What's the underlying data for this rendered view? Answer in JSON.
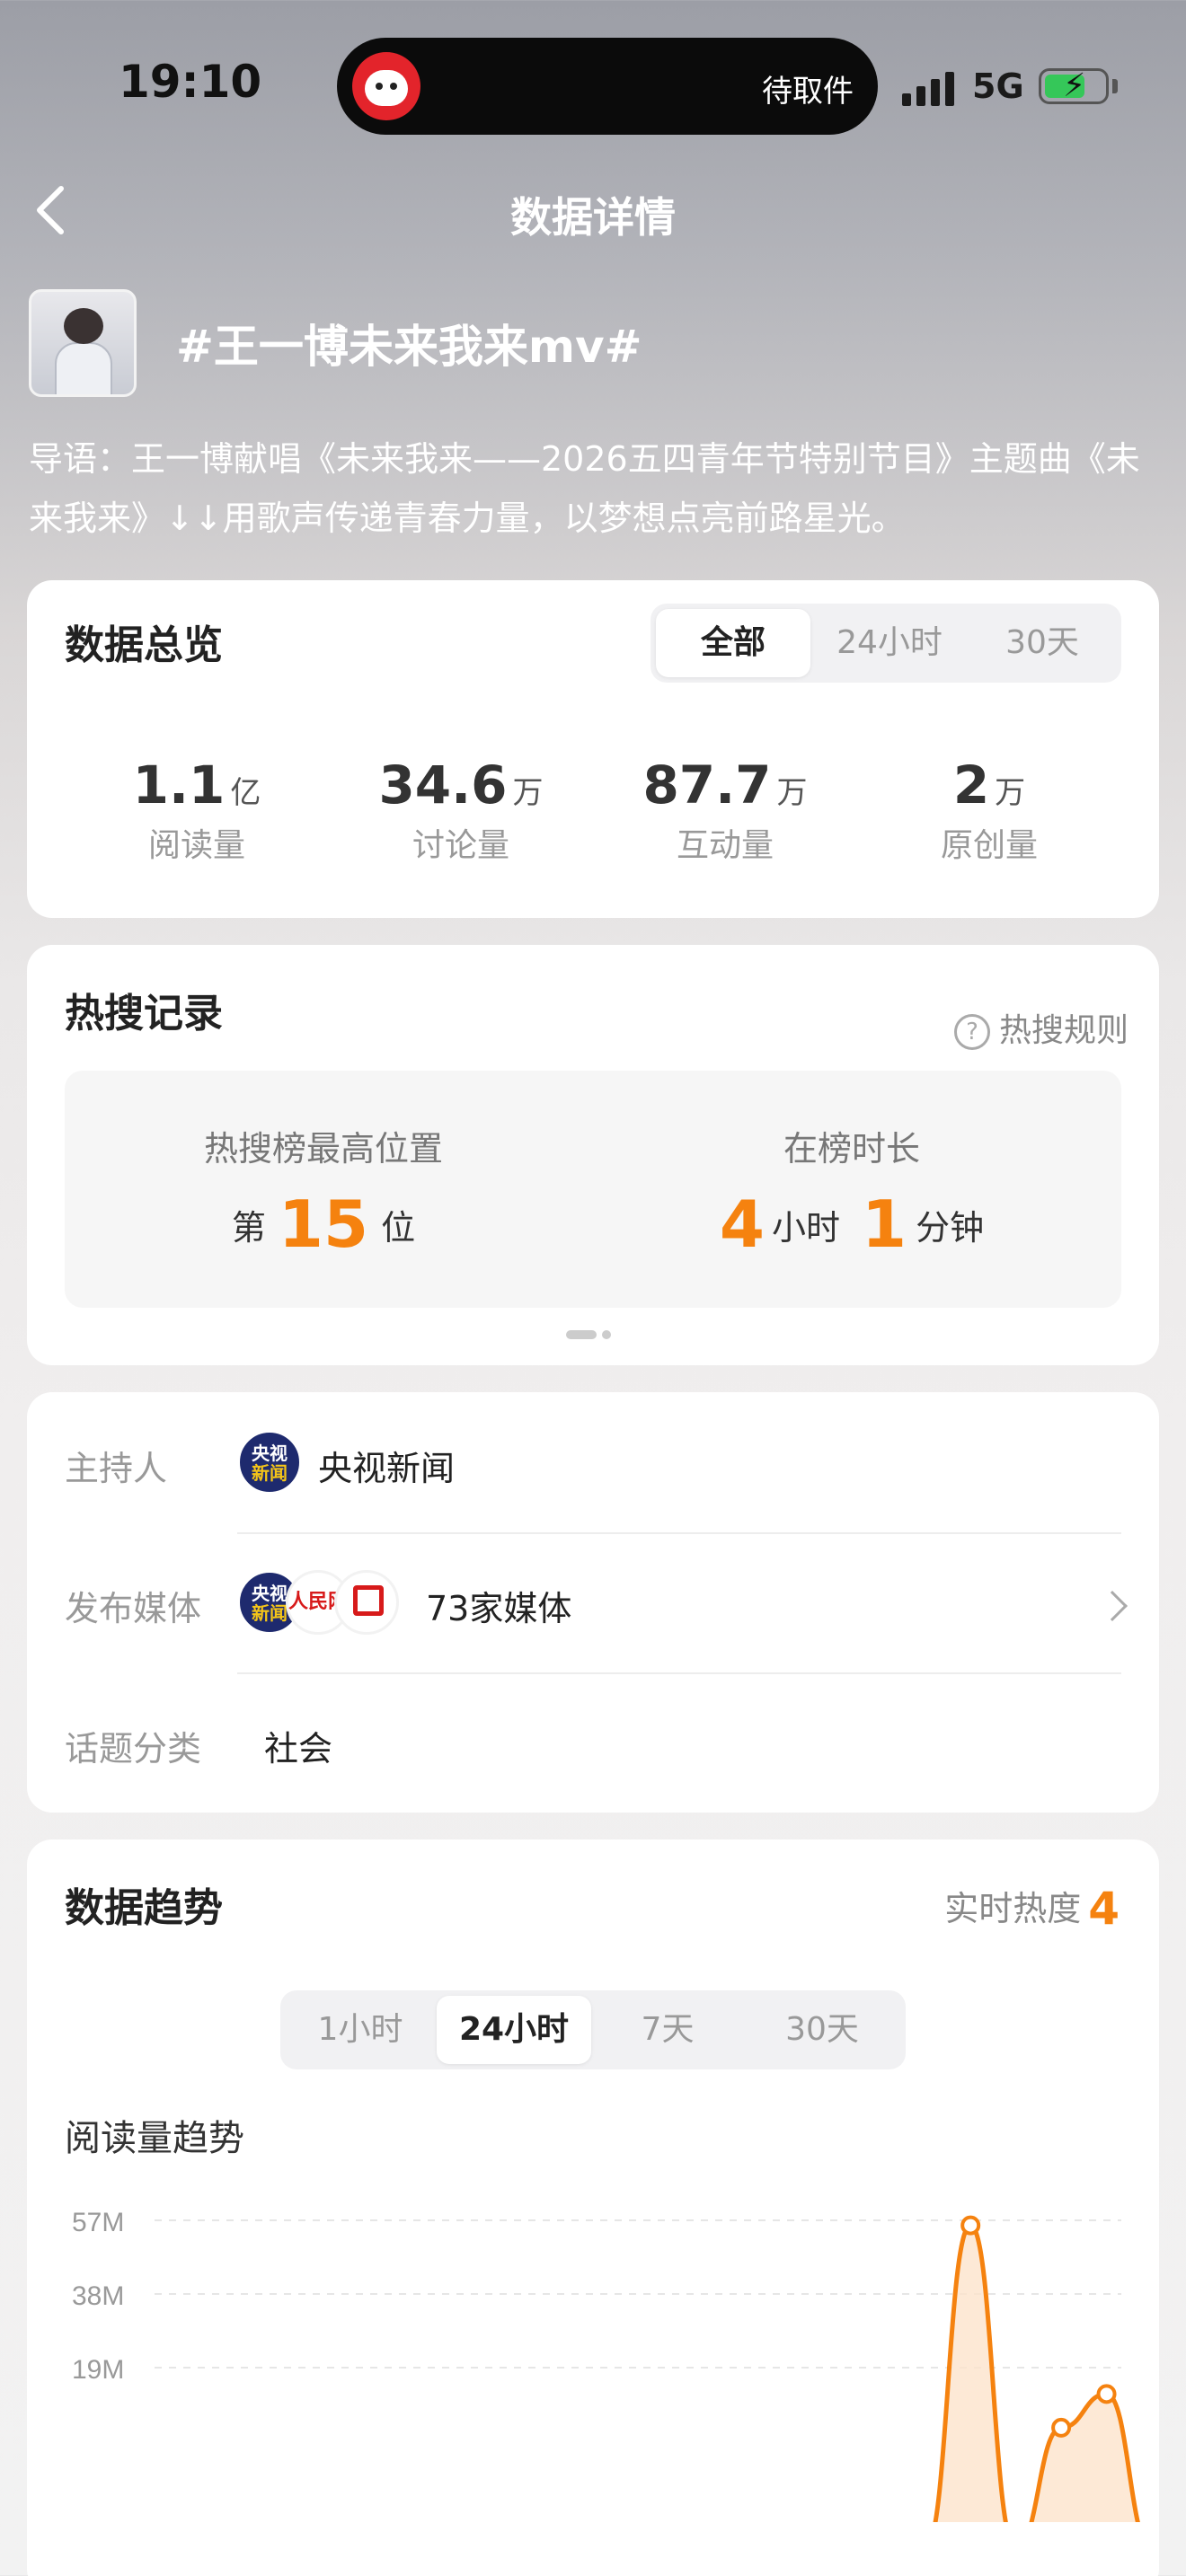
{
  "status_bar": {
    "time": "19:10",
    "island_text": "待取件",
    "network": "5G"
  },
  "nav": {
    "title": "数据详情"
  },
  "topic": {
    "title": "#王一博未来我来mv#",
    "lead": "导语：王一博献唱《未来我来——2026五四青年节特别节目》主题曲《未来我来》↓↓用歌声传递青春力量，以梦想点亮前路星光。"
  },
  "overview": {
    "title": "数据总览",
    "tabs": [
      "全部",
      "24小时",
      "30天"
    ],
    "active_tab": "全部",
    "stats": [
      {
        "value": "1.1",
        "unit": "亿",
        "label": "阅读量"
      },
      {
        "value": "34.6",
        "unit": "万",
        "label": "讨论量"
      },
      {
        "value": "87.7",
        "unit": "万",
        "label": "互动量"
      },
      {
        "value": "2",
        "unit": "万",
        "label": "原创量"
      }
    ]
  },
  "hot_search": {
    "title": "热搜记录",
    "rule_label": "热搜规则",
    "peak_label": "热搜榜最高位置",
    "peak_prefix": "第",
    "peak_value": "15",
    "peak_suffix": "位",
    "duration_label": "在榜时长",
    "duration_hours": "4",
    "hours_unit": "小时",
    "duration_minutes": "1",
    "minutes_unit": "分钟"
  },
  "info": {
    "host_label": "主持人",
    "host_logo_top": "央视",
    "host_logo_bottom": "新闻",
    "host_value": "央视新闻",
    "media_label": "发布媒体",
    "media_value": "73家媒体",
    "rm_logo": "人民网",
    "category_label": "话题分类",
    "category_value": "社会"
  },
  "trend": {
    "title": "数据趋势",
    "heat_label": "实时热度",
    "heat_value": "4",
    "tabs": [
      "1小时",
      "24小时",
      "7天",
      "30天"
    ],
    "active_tab": "24小时",
    "subtitle": "阅读量趋势"
  },
  "chart_data": {
    "type": "area",
    "title": "阅读量趋势",
    "y_tick_labels": [
      "57M",
      "38M",
      "19M"
    ],
    "y_ticks": [
      57,
      38,
      19
    ],
    "ylim": [
      0,
      60
    ],
    "unit": "M",
    "series": [
      {
        "values": [
          0,
          0,
          0,
          0,
          0,
          0,
          0,
          0,
          0,
          0,
          0,
          0,
          0,
          0,
          0,
          0,
          0,
          0,
          55.7,
          0,
          3.5,
          12.2,
          0
        ]
      }
    ],
    "grid": true,
    "colors": {
      "line": "#f5820f",
      "fill": "#fde3cc"
    }
  },
  "colors": {
    "accent": "#f5820f",
    "card_bg": "#ffffff"
  }
}
